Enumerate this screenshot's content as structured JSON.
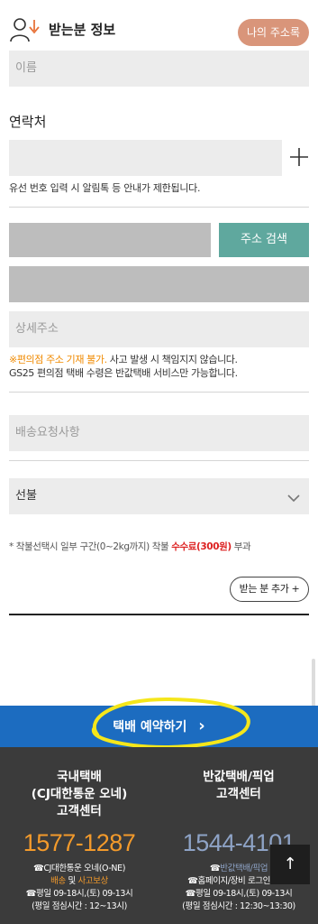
{
  "header": {
    "title": "받는분 정보",
    "address_book_label": "나의 주소록"
  },
  "form": {
    "name_placeholder": "이름",
    "contact_label": "연락처",
    "phone_note": "유선 번호 입력 시 알림톡 등 안내가 제한됩니다.",
    "search_address_label": "주소 검색",
    "detail_address_placeholder": "상세주소",
    "warning_emphasis": "※편의점 주소 기재 불가.",
    "warning_rest": " 사고 발생 시 책임지지 않습니다.",
    "warning_line2": "GS25 편의점 택배 수령은 반값택배 서비스만 가능합니다.",
    "delivery_request_placeholder": "배송요청사항",
    "payment_selected": "선불",
    "fee_note_prefix": "* 착불선택시 일부 구간(0~2kg까지) 착불 ",
    "fee_note_highlight": "수수료(300원)",
    "fee_note_suffix": " 부과",
    "add_recipient_label": "받는 분 추가 +"
  },
  "reserve": {
    "label": "택배 예약하기",
    "arrow": "›"
  },
  "footer": {
    "left": {
      "title_line1": "국내택배",
      "title_line2": "(CJ대한통운 오네)",
      "title_line3": "고객센터",
      "phone": "1577-1287",
      "line1": "☎CJ대한통운 오네(O-NE)",
      "line2_a": "배송",
      "line2_b": " 및 ",
      "line2_c": "사고보상",
      "line3": "☎평일 09-18시,(토) 09-13시",
      "line4": "(평일 점심시간 : 12~13시)"
    },
    "right": {
      "title_line1": "반값택배/픽업",
      "title_line2": "고객센터",
      "phone": "1544-4101",
      "line1_a": "☎",
      "line1_b": "반값택배/픽업",
      "line2": "☎홈페이지/장비 로그인, 제휴",
      "line3": "☎평일 09-18시,(토) 09-13시",
      "line4": "(평일 점심시간 : 12:30~13:30)"
    },
    "top_button": "↑"
  },
  "colors": {
    "accent_salmon": "#d9957a",
    "teal_button": "#5fa89e",
    "reserve_blue": "#1c6cc0",
    "highlight_yellow": "#f5e61a",
    "phone_orange": "#f39a2b",
    "phone_blue": "#8ea3c6",
    "footer_bg": "#3b3b3b"
  }
}
